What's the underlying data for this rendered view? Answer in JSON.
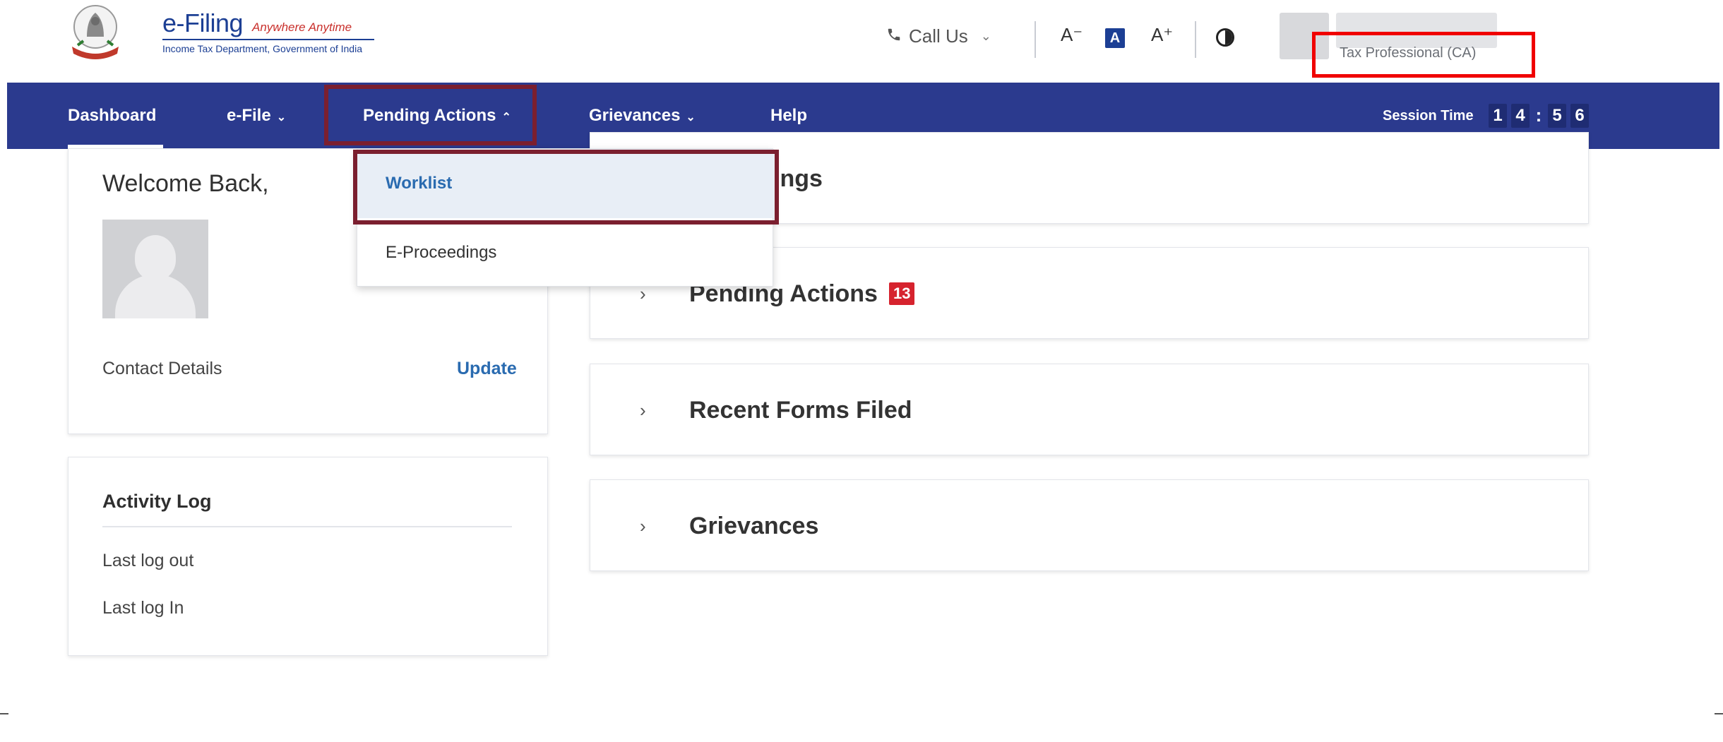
{
  "header": {
    "logo_title": "e-Filing",
    "logo_tagline": "Anywhere Anytime",
    "logo_subtitle": "Income Tax Department, Government of India",
    "call_us": "Call Us",
    "font_decrease": "A⁻",
    "font_default": "A",
    "font_increase": "A⁺",
    "role": "Tax Professional (CA)"
  },
  "nav": {
    "items": [
      {
        "label": "Dashboard"
      },
      {
        "label": "e-File"
      },
      {
        "label": "Pending Actions"
      },
      {
        "label": "Grievances"
      },
      {
        "label": "Help"
      }
    ],
    "session_label": "Session Time",
    "session_digits": [
      "1",
      "4",
      ":",
      "5",
      "6"
    ]
  },
  "dropdown": {
    "items": [
      {
        "label": "Worklist"
      },
      {
        "label": "E-Proceedings"
      }
    ]
  },
  "welcome": {
    "title": "Welcome Back,",
    "contact_label": "Contact Details",
    "update_link": "Update"
  },
  "activity": {
    "title": "Activity Log",
    "last_logout": "Last log out",
    "last_login": "Last log In"
  },
  "accordions": [
    {
      "title": "ears Filings"
    },
    {
      "title": "Pending Actions",
      "badge": "13"
    },
    {
      "title": "Recent Forms Filed"
    },
    {
      "title": "Grievances"
    }
  ],
  "icons": {
    "phone": "phone-icon",
    "chevron_down": "chevron-down-icon",
    "chevron_up": "chevron-up-icon",
    "chevron_right": "chevron-right-icon",
    "contrast": "contrast-icon",
    "emblem": "emblem-icon",
    "avatar": "avatar-placeholder-icon"
  },
  "colors": {
    "nav_bg": "#2b3a8e",
    "brand_blue": "#1c3f94",
    "link_blue": "#2a6bb0",
    "badge_red": "#d6232e",
    "highlight_red": "#f00000",
    "highlight_maroon": "#7b1f2f"
  }
}
